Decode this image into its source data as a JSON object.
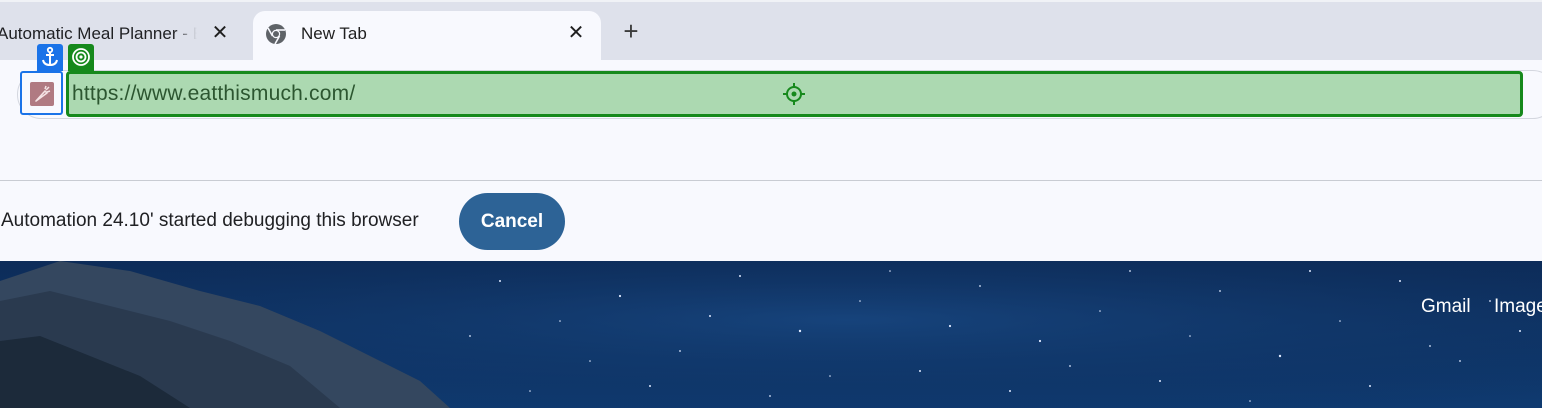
{
  "tabs": [
    {
      "title": "Automatic Meal Planner - Eat This Much",
      "active": false
    },
    {
      "title": "New Tab",
      "active": true
    }
  ],
  "new_tab_symbol": "+",
  "close_symbol": "✕",
  "omnibox": {
    "url": "https://www.eatthismuch.com/"
  },
  "infobar": {
    "message": "Automation 24.10' started debugging this browser",
    "cancel_label": "Cancel"
  },
  "page": {
    "links": [
      "Gmail",
      "Images"
    ]
  },
  "colors": {
    "tabstrip": "#dee1eb",
    "active_tab": "#f8f9fe",
    "url_highlight": "#acd9b1",
    "url_highlight_border": "#16891c",
    "site_chip_border": "#1a73e8",
    "cancel_button": "#2d6396"
  },
  "icons": {
    "active_tab_favicon": "chrome-icon",
    "site_chip": "carrot-icon",
    "anchor_badge": "anchor-icon",
    "target_badge": "target-icon",
    "url_center": "crosshair-icon"
  }
}
